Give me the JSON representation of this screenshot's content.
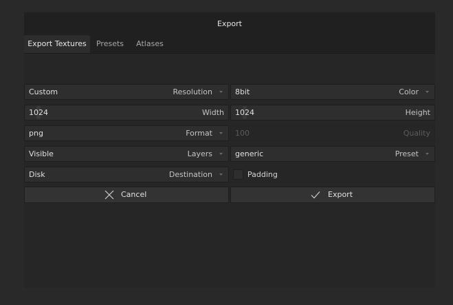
{
  "dialog": {
    "title": "Export",
    "tabs": [
      {
        "label": "Export Textures",
        "active": true
      },
      {
        "label": "Presets",
        "active": false
      },
      {
        "label": "Atlases",
        "active": false
      }
    ]
  },
  "form": {
    "resolution": {
      "value": "Custom",
      "label": "Resolution"
    },
    "color": {
      "value": "8bit",
      "label": "Color"
    },
    "width": {
      "value": "1024",
      "label": "Width"
    },
    "height": {
      "value": "1024",
      "label": "Height"
    },
    "format": {
      "value": "png",
      "label": "Format"
    },
    "quality": {
      "value": "100",
      "label": "Quality",
      "disabled": true
    },
    "layers": {
      "value": "Visible",
      "label": "Layers"
    },
    "preset": {
      "value": "generic",
      "label": "Preset"
    },
    "destination": {
      "value": "Disk",
      "label": "Destination"
    },
    "padding": {
      "label": "Padding",
      "checked": false
    }
  },
  "buttons": {
    "cancel": {
      "label": "Cancel",
      "icon": "close-icon"
    },
    "export": {
      "label": "Export",
      "icon": "check-icon"
    }
  },
  "colors": {
    "background": "#292929",
    "dialog": "#262626",
    "field": "#2e2e2e",
    "text": "#e0e0e0"
  }
}
